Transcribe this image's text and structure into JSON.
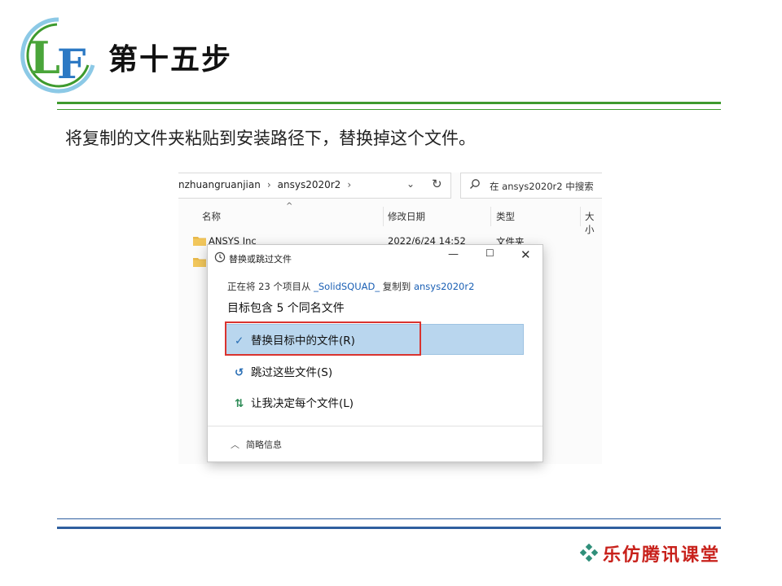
{
  "slide": {
    "title": "第十五步",
    "instruction": "将复制的文件夹粘贴到安装路径下，替换掉这个文件。",
    "brand": "乐仿腾讯课堂",
    "logo_text": "LF"
  },
  "explorer": {
    "breadcrumb": [
      "nzhuangruanjian",
      "ansys2020r2"
    ],
    "search_placeholder": "在 ansys2020r2 中搜索",
    "columns": [
      "名称",
      "修改日期",
      "类型",
      "大小"
    ],
    "rows": [
      {
        "name": "ANSYS Inc",
        "modified": "2022/6/24 14:52",
        "type": "文件夹"
      }
    ]
  },
  "dialog": {
    "title": "替换或跳过文件",
    "status_prefix": "正在将 23 个项目从",
    "source": "_SolidSQUAD_",
    "status_mid": "复制到",
    "destination": "ansys2020r2",
    "conflict": "目标包含 5 个同名文件",
    "options": [
      {
        "label": "替换目标中的文件(R)",
        "icon": "check-icon"
      },
      {
        "label": "跳过这些文件(S)",
        "icon": "skip-icon"
      },
      {
        "label": "让我决定每个文件(L)",
        "icon": "decide-icon"
      }
    ],
    "details_label": "简略信息"
  },
  "colors": {
    "green_rule": "#3e9a2e",
    "blue_rule": "#2f5f9f",
    "highlight": "#b9d6ee",
    "red_box": "#d9332f",
    "brand_red": "#c8211b"
  }
}
